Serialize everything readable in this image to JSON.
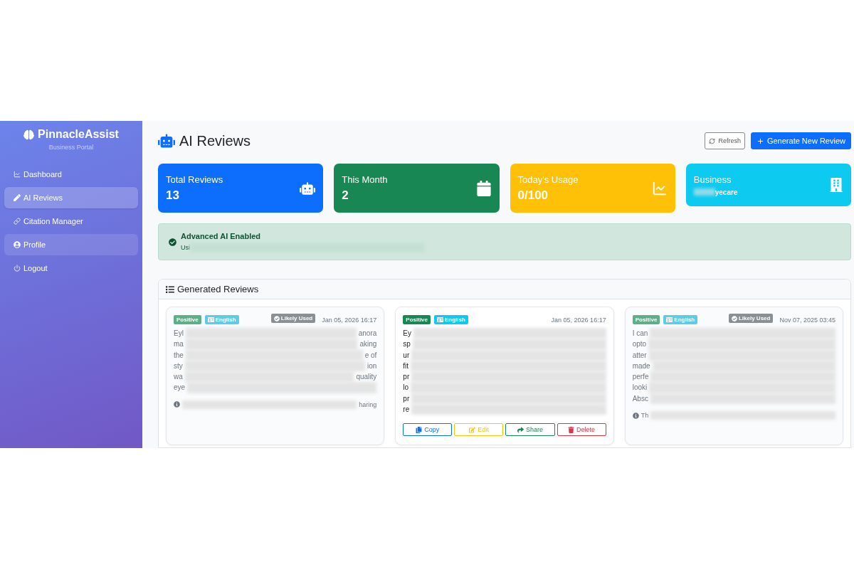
{
  "sidebar": {
    "brand": "PinnacleAssist",
    "subtitle": "Business Portal",
    "items": [
      {
        "label": "Dashboard",
        "selected": false,
        "hovered": false
      },
      {
        "label": "AI Reviews",
        "selected": true,
        "hovered": false
      },
      {
        "label": "Citation Manager",
        "selected": false,
        "hovered": false
      },
      {
        "label": "Profile",
        "selected": false,
        "hovered": true
      },
      {
        "label": "Logout",
        "selected": false,
        "hovered": false
      }
    ]
  },
  "header": {
    "title": "AI Reviews",
    "buttons": [
      {
        "label": "Refresh",
        "kind": "outline"
      },
      {
        "label": "Generate New Review",
        "kind": "primary"
      }
    ]
  },
  "stats": [
    {
      "label": "Total Reviews",
      "value": "13",
      "kind": "count",
      "color": "#0d6efd"
    },
    {
      "label": "This Month",
      "value": "2",
      "kind": "count",
      "color": "#198754"
    },
    {
      "label": "Today's Usage",
      "value": "0/100",
      "kind": "count",
      "color": "#ffc107"
    },
    {
      "label": "Business",
      "value": "yecare",
      "kind": "name",
      "color": "#0dcaf0"
    }
  ],
  "alert": {
    "title": "Advanced AI Enabled",
    "text": "Usi"
  },
  "reviews_panel": {
    "title": "Generated Reviews",
    "reviews": [
      {
        "sentiment": "Positive",
        "language": "English",
        "likely_used": true,
        "badge": "Likely Used",
        "date": "Jan 05, 2026 16:17",
        "lines": [
          {
            "left": "Eyl",
            "right": "anora"
          },
          {
            "left": "ma",
            "right": "aking"
          },
          {
            "left": "the",
            "right": "e of"
          },
          {
            "left": "sty",
            "right": "ion"
          },
          {
            "left": "wa",
            "right": "quality"
          },
          {
            "left": "eye"
          }
        ],
        "note": {
          "right": "haring"
        }
      },
      {
        "sentiment": "Positive",
        "language": "English",
        "likely_used": false,
        "date": "Jan 05, 2026 16:17",
        "lines": [
          {
            "left": "Ey"
          },
          {
            "left": "sp"
          },
          {
            "left": "ur"
          },
          {
            "left": "fit"
          },
          {
            "left": "pr"
          },
          {
            "left": "lo"
          },
          {
            "left": "pr"
          },
          {
            "left": "re"
          }
        ],
        "actions": [
          {
            "label": "Copy",
            "kind": "copy"
          },
          {
            "label": "Edit",
            "kind": "edit"
          },
          {
            "label": "Share",
            "kind": "share"
          },
          {
            "label": "Delete",
            "kind": "delete"
          }
        ]
      },
      {
        "sentiment": "Positive",
        "language": "English",
        "likely_used": true,
        "badge": "Likely Used",
        "date": "Nov 07, 2025 03:45",
        "lines": [
          {
            "left": "I can"
          },
          {
            "left": "opto"
          },
          {
            "left": "atter"
          },
          {
            "left": "made"
          },
          {
            "left": "perfe"
          },
          {
            "left": "looki"
          },
          {
            "left": "Absc"
          }
        ],
        "note": {
          "left": "Th"
        }
      }
    ]
  }
}
